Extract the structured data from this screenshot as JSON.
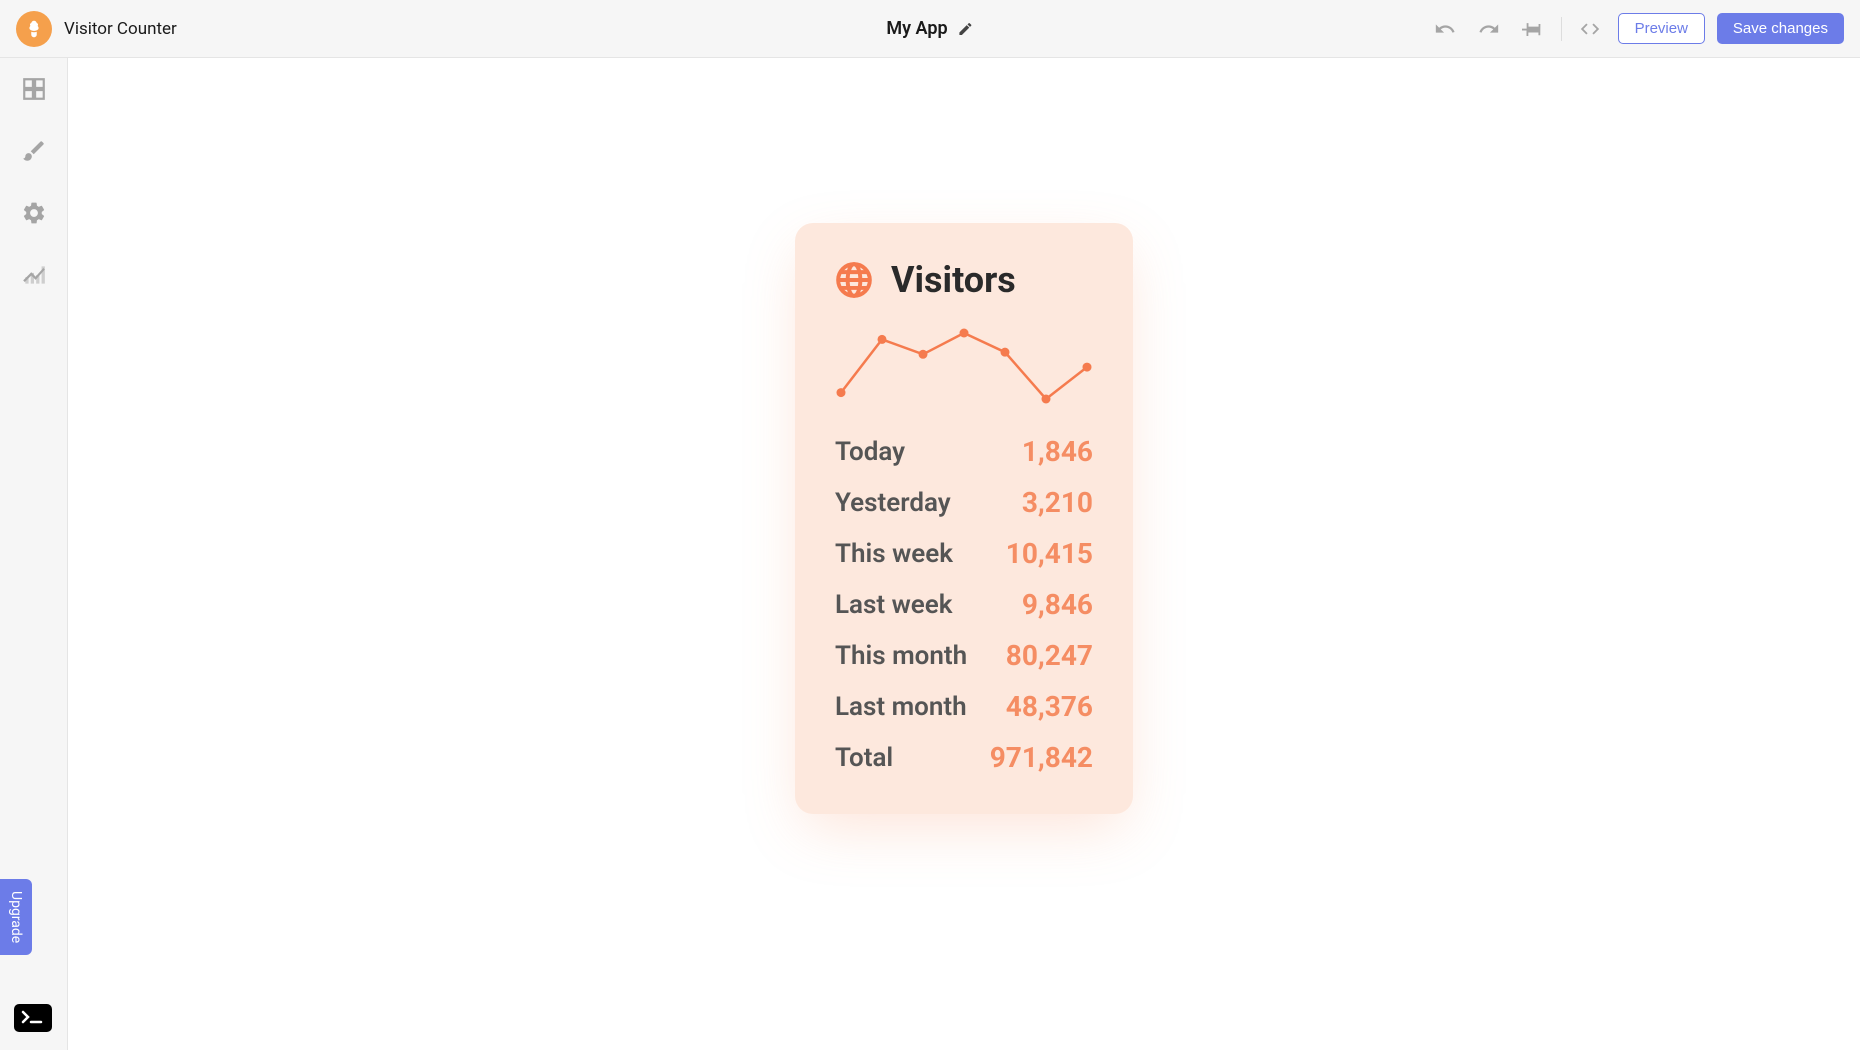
{
  "header": {
    "app_name": "Visitor Counter",
    "project_name": "My App",
    "preview_label": "Preview",
    "save_label": "Save changes"
  },
  "sidebar": {
    "upgrade_label": "Upgrade"
  },
  "card": {
    "title": "Visitors",
    "stats": [
      {
        "label": "Today",
        "value": "1,846"
      },
      {
        "label": "Yesterday",
        "value": "3,210"
      },
      {
        "label": "This week",
        "value": "10,415"
      },
      {
        "label": "Last week",
        "value": "9,846"
      },
      {
        "label": "This month",
        "value": "80,247"
      },
      {
        "label": "Last month",
        "value": "48,376"
      },
      {
        "label": "Total",
        "value": "971,842"
      }
    ]
  },
  "colors": {
    "accent": "#f57b4e",
    "value_text": "#f58d63",
    "card_bg": "#fde8dd",
    "primary_button": "#6c7ce8"
  },
  "chart_data": {
    "type": "line",
    "title": "",
    "xlabel": "",
    "ylabel": "",
    "x": [
      0,
      1,
      2,
      3,
      4,
      5,
      6
    ],
    "values": [
      10,
      60,
      46,
      66,
      48,
      4,
      34
    ]
  }
}
